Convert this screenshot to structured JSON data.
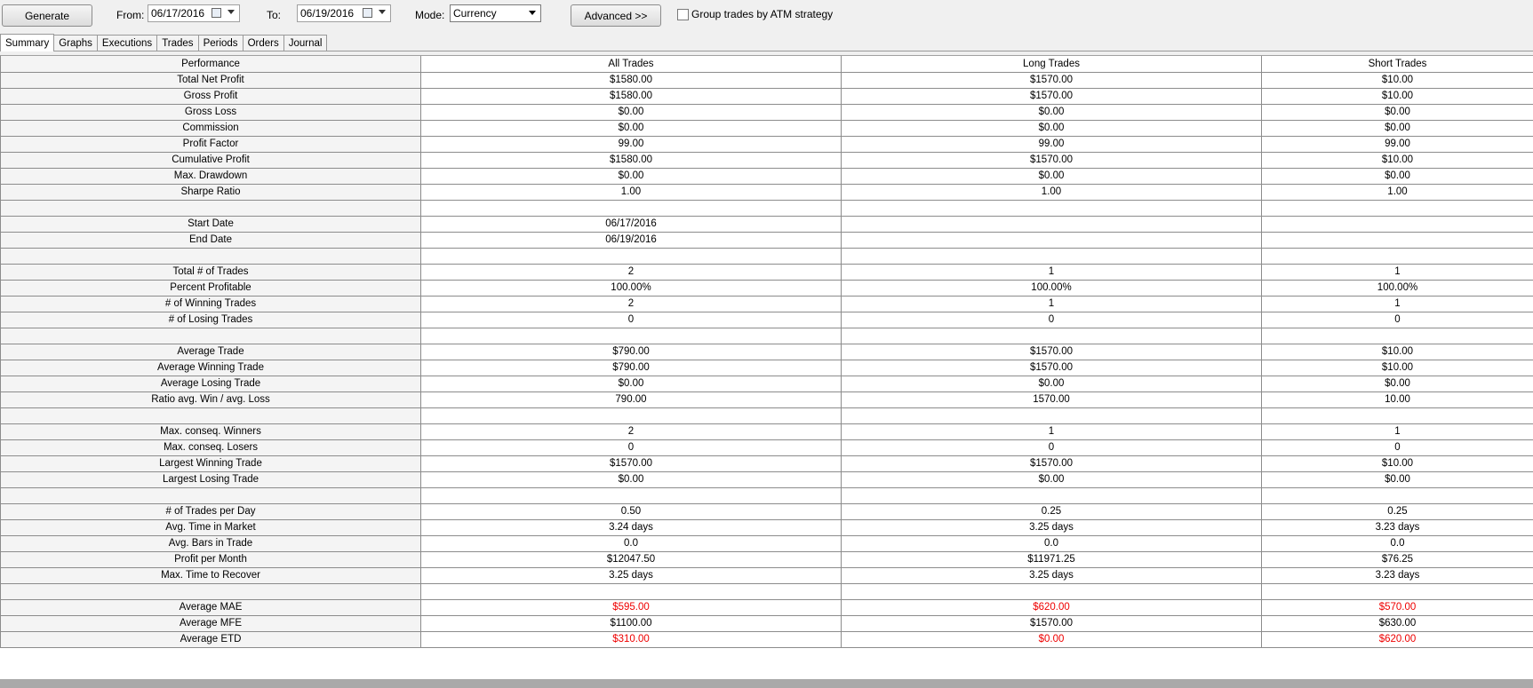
{
  "toolbar": {
    "generate_label": "Generate",
    "from_label": "From:",
    "from_value": "06/17/2016",
    "to_label": "To:",
    "to_value": "06/19/2016",
    "mode_label": "Mode:",
    "mode_value": "Currency",
    "advanced_label": "Advanced >>",
    "group_label": "Group trades by ATM strategy"
  },
  "tabs": [
    "Summary",
    "Graphs",
    "Executions",
    "Trades",
    "Periods",
    "Orders",
    "Journal"
  ],
  "active_tab": "Summary",
  "colors": {
    "negative_text": "#ee0000",
    "label_column_bg": "#f4f4f4"
  },
  "grid": {
    "headers": [
      "Performance",
      "All Trades",
      "Long Trades",
      "Short Trades"
    ],
    "rows": [
      [
        "Total Net Profit",
        "$1580.00",
        "$1570.00",
        "$10.00"
      ],
      [
        "Gross Profit",
        "$1580.00",
        "$1570.00",
        "$10.00"
      ],
      [
        "Gross Loss",
        "$0.00",
        "$0.00",
        "$0.00"
      ],
      [
        "Commission",
        "$0.00",
        "$0.00",
        "$0.00"
      ],
      [
        "Profit Factor",
        "99.00",
        "99.00",
        "99.00"
      ],
      [
        "Cumulative Profit",
        "$1580.00",
        "$1570.00",
        "$10.00"
      ],
      [
        "Max. Drawdown",
        "$0.00",
        "$0.00",
        "$0.00"
      ],
      [
        "Sharpe Ratio",
        "1.00",
        "1.00",
        "1.00"
      ],
      [
        "",
        "",
        "",
        ""
      ],
      [
        "Start Date",
        "06/17/2016",
        "",
        ""
      ],
      [
        "End Date",
        "06/19/2016",
        "",
        ""
      ],
      [
        "",
        "",
        "",
        ""
      ],
      [
        "Total # of Trades",
        "2",
        "1",
        "1"
      ],
      [
        "Percent Profitable",
        "100.00%",
        "100.00%",
        "100.00%"
      ],
      [
        "# of Winning Trades",
        "2",
        "1",
        "1"
      ],
      [
        "# of Losing Trades",
        "0",
        "0",
        "0"
      ],
      [
        "",
        "",
        "",
        ""
      ],
      [
        "Average Trade",
        "$790.00",
        "$1570.00",
        "$10.00"
      ],
      [
        "Average Winning Trade",
        "$790.00",
        "$1570.00",
        "$10.00"
      ],
      [
        "Average Losing Trade",
        "$0.00",
        "$0.00",
        "$0.00"
      ],
      [
        "Ratio avg. Win / avg. Loss",
        "790.00",
        "1570.00",
        "10.00"
      ],
      [
        "",
        "",
        "",
        ""
      ],
      [
        "Max. conseq. Winners",
        "2",
        "1",
        "1"
      ],
      [
        "Max. conseq. Losers",
        "0",
        "0",
        "0"
      ],
      [
        "Largest Winning Trade",
        "$1570.00",
        "$1570.00",
        "$10.00"
      ],
      [
        "Largest Losing Trade",
        "$0.00",
        "$0.00",
        "$0.00"
      ],
      [
        "",
        "",
        "",
        ""
      ],
      [
        "# of Trades per Day",
        "0.50",
        "0.25",
        "0.25"
      ],
      [
        "Avg. Time in Market",
        "3.24 days",
        "3.25 days",
        "3.23 days"
      ],
      [
        "Avg. Bars in Trade",
        "0.0",
        "0.0",
        "0.0"
      ],
      [
        "Profit per Month",
        "$12047.50",
        "$11971.25",
        "$76.25"
      ],
      [
        "Max. Time to Recover",
        "3.25 days",
        "3.25 days",
        "3.23 days"
      ],
      [
        "",
        "",
        "",
        ""
      ],
      [
        "Average MAE",
        "$595.00",
        "$620.00",
        "$570.00"
      ],
      [
        "Average MFE",
        "$1100.00",
        "$1570.00",
        "$630.00"
      ],
      [
        "Average ETD",
        "$310.00",
        "$0.00",
        "$620.00"
      ]
    ],
    "negative_rows": [
      "Average MAE",
      "Average ETD"
    ],
    "negative_cells": [
      [
        "Average MFE",
        3
      ]
    ]
  }
}
